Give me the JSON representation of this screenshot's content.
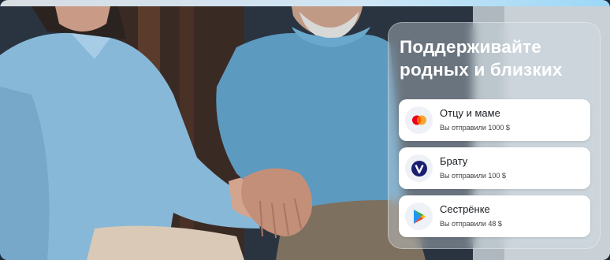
{
  "panel": {
    "title": "Поддерживайте\nродных и близких"
  },
  "recipients": [
    {
      "name": "Отцу и маме",
      "sent": "Вы отправили 1000 $",
      "icon": "mastercard-icon"
    },
    {
      "name": "Брату",
      "sent": "Вы отправили 100 $",
      "icon": "visa-v-icon"
    },
    {
      "name": "Сестрёнке",
      "sent": "Вы отправили 48 $",
      "icon": "play-store-icon"
    }
  ],
  "colors": {
    "mastercard_red": "#eb001b",
    "mastercard_orange": "#f79e1b",
    "visa_blue": "#1a1f71"
  }
}
